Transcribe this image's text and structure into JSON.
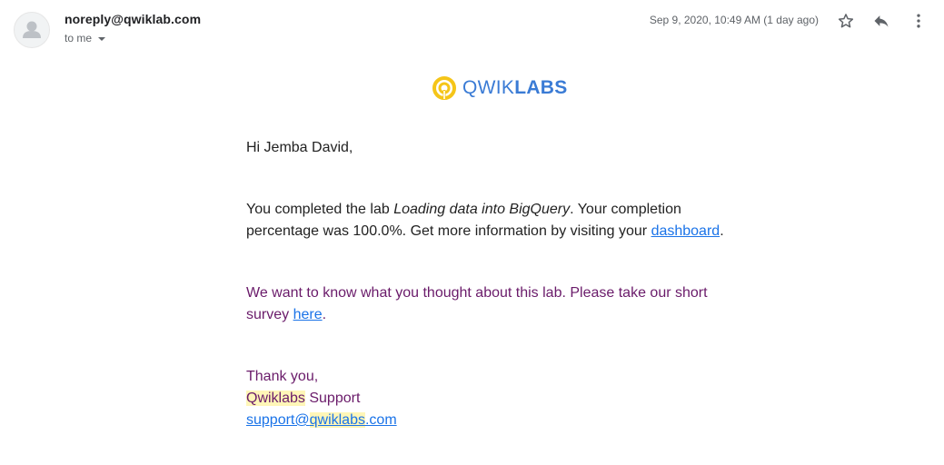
{
  "header": {
    "sender": "noreply@qwiklab.com",
    "recipient_label": "to me",
    "date": "Sep 9, 2020, 10:49 AM (1 day ago)",
    "icons": [
      "star-icon",
      "reply-icon",
      "more-vert-icon"
    ]
  },
  "logo": {
    "light_text": "QWIK",
    "bold_text": "LABS",
    "brand_color": "#3a7bd5",
    "mark_color": "#f5c518"
  },
  "message": {
    "greeting": "Hi Jemba David,",
    "completion_pre": "You completed the lab ",
    "lab_name": "Loading data into BigQuery",
    "completion_mid": ". Your completion",
    "completion_line2": "percentage was 100.0%. Get more information by visiting your ",
    "dashboard_link": "dashboard",
    "completion_end": ".",
    "survey_line1": "We want to know what you thought about this lab. Please take our short",
    "survey_pre": "survey ",
    "survey_link": "here",
    "survey_end": ".",
    "thanks": "Thank you,",
    "signature_brand": "Qwiklabs",
    "signature_rest": " Support",
    "email_pre": "support@",
    "email_brand": "qwiklabs",
    "email_post": ".com"
  },
  "colors": {
    "link": "#1a73e8",
    "purple_text": "#6a1b6a",
    "highlight": "#fff6b8"
  }
}
